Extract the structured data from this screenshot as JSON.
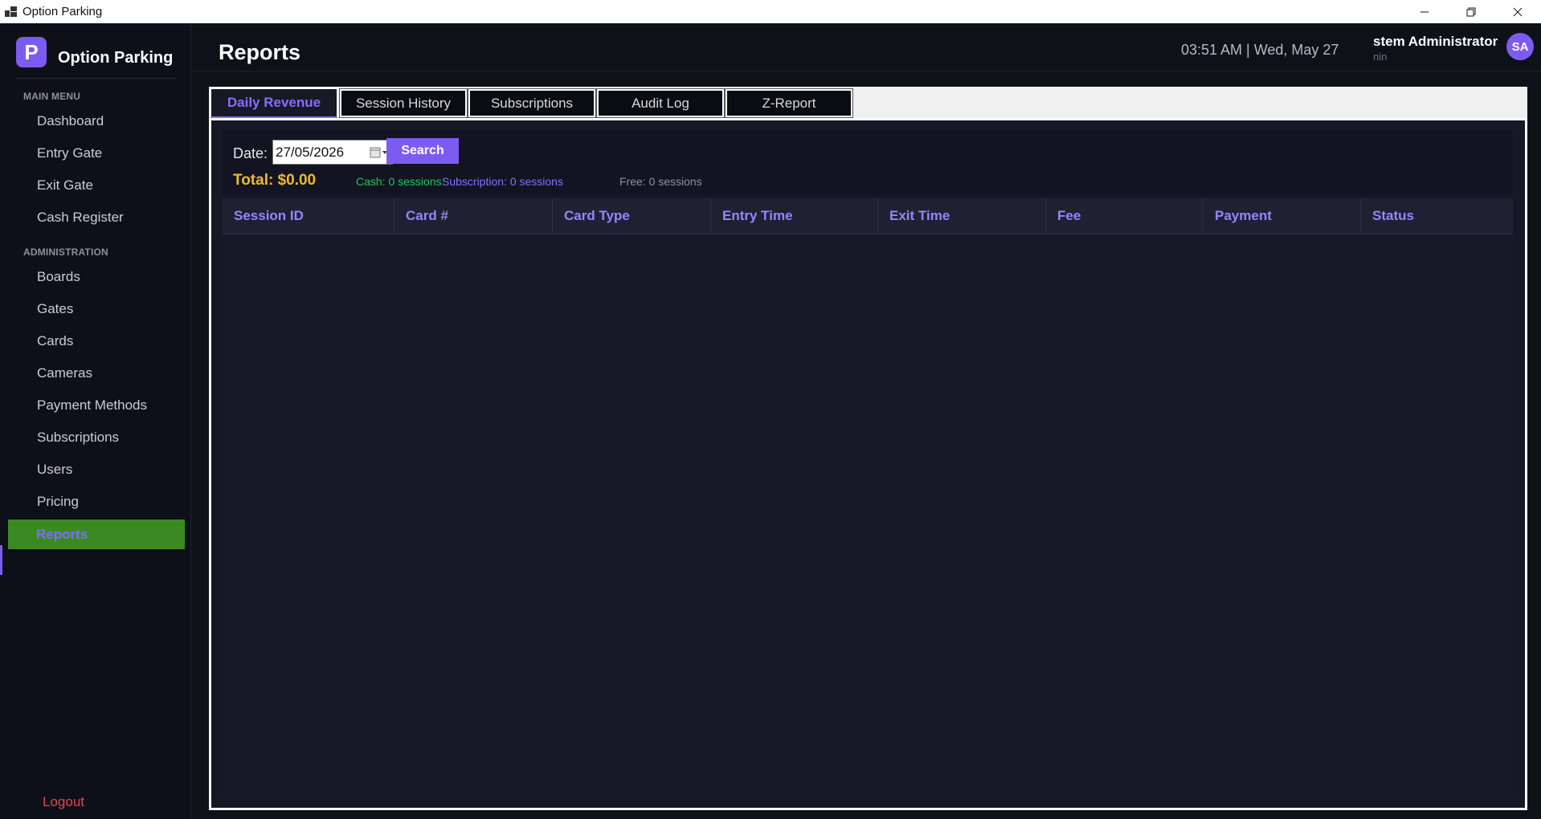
{
  "window": {
    "title": "Option Parking"
  },
  "sidebar": {
    "brand_initial": "P",
    "brand_name": "Option Parking",
    "sections": [
      {
        "title": "MAIN MENU",
        "items": [
          {
            "label": "Dashboard"
          },
          {
            "label": "Entry Gate"
          },
          {
            "label": "Exit Gate"
          },
          {
            "label": "Cash Register"
          }
        ]
      },
      {
        "title": "ADMINISTRATION",
        "items": [
          {
            "label": "Boards"
          },
          {
            "label": "Gates"
          },
          {
            "label": "Cards"
          },
          {
            "label": "Cameras"
          },
          {
            "label": "Payment Methods"
          },
          {
            "label": "Subscriptions"
          },
          {
            "label": "Users"
          },
          {
            "label": "Pricing"
          },
          {
            "label": "Reports",
            "active": true
          }
        ]
      }
    ],
    "logout_label": "Logout"
  },
  "header": {
    "title": "Reports",
    "clock": "03:51 AM  |  Wed, May 27",
    "user_name": "stem Administrator",
    "user_role": "nin",
    "avatar_initials": "SA"
  },
  "tabs": [
    {
      "label": "Daily Revenue",
      "active": true
    },
    {
      "label": "Session History"
    },
    {
      "label": "Subscriptions"
    },
    {
      "label": "Audit Log"
    },
    {
      "label": "Z-Report"
    }
  ],
  "filter": {
    "date_label": "Date:",
    "date_value": "27/05/2026",
    "search_label": "Search",
    "total": "Total: $0.00",
    "cash": "Cash: 0 sessions",
    "subscription": "Subscription: 0 sessions",
    "free": "Free: 0 sessions"
  },
  "table": {
    "columns": [
      "Session ID",
      "Card #",
      "Card Type",
      "Entry Time",
      "Exit Time",
      "Fee",
      "Payment",
      "Status"
    ],
    "rows": []
  },
  "colors": {
    "accent": "#7c5cf0",
    "active_nav_bg": "#3a8a22",
    "total": "#f5b82e",
    "cash": "#22c55e",
    "logout": "#e0464f"
  },
  "icons": [
    "app-window-icon",
    "minimize-icon",
    "restore-icon",
    "close-icon",
    "calendar-dropdown-icon"
  ]
}
